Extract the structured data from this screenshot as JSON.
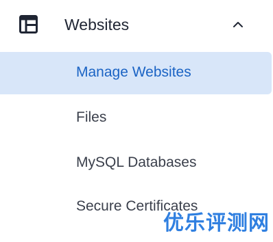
{
  "section": {
    "title": "Websites",
    "icon": "layout-icon",
    "expanded": true
  },
  "items": [
    {
      "label": "Manage Websites",
      "active": true
    },
    {
      "label": "Files",
      "active": false
    },
    {
      "label": "MySQL Databases",
      "active": false
    },
    {
      "label": "Secure Certificates",
      "active": false
    }
  ],
  "watermark": {
    "text": "优乐评测网"
  },
  "colors": {
    "active_background": "#d8e6f9",
    "active_text": "#1a63c4",
    "text": "#3a3f4b",
    "watermark": "#2f7fe0"
  }
}
